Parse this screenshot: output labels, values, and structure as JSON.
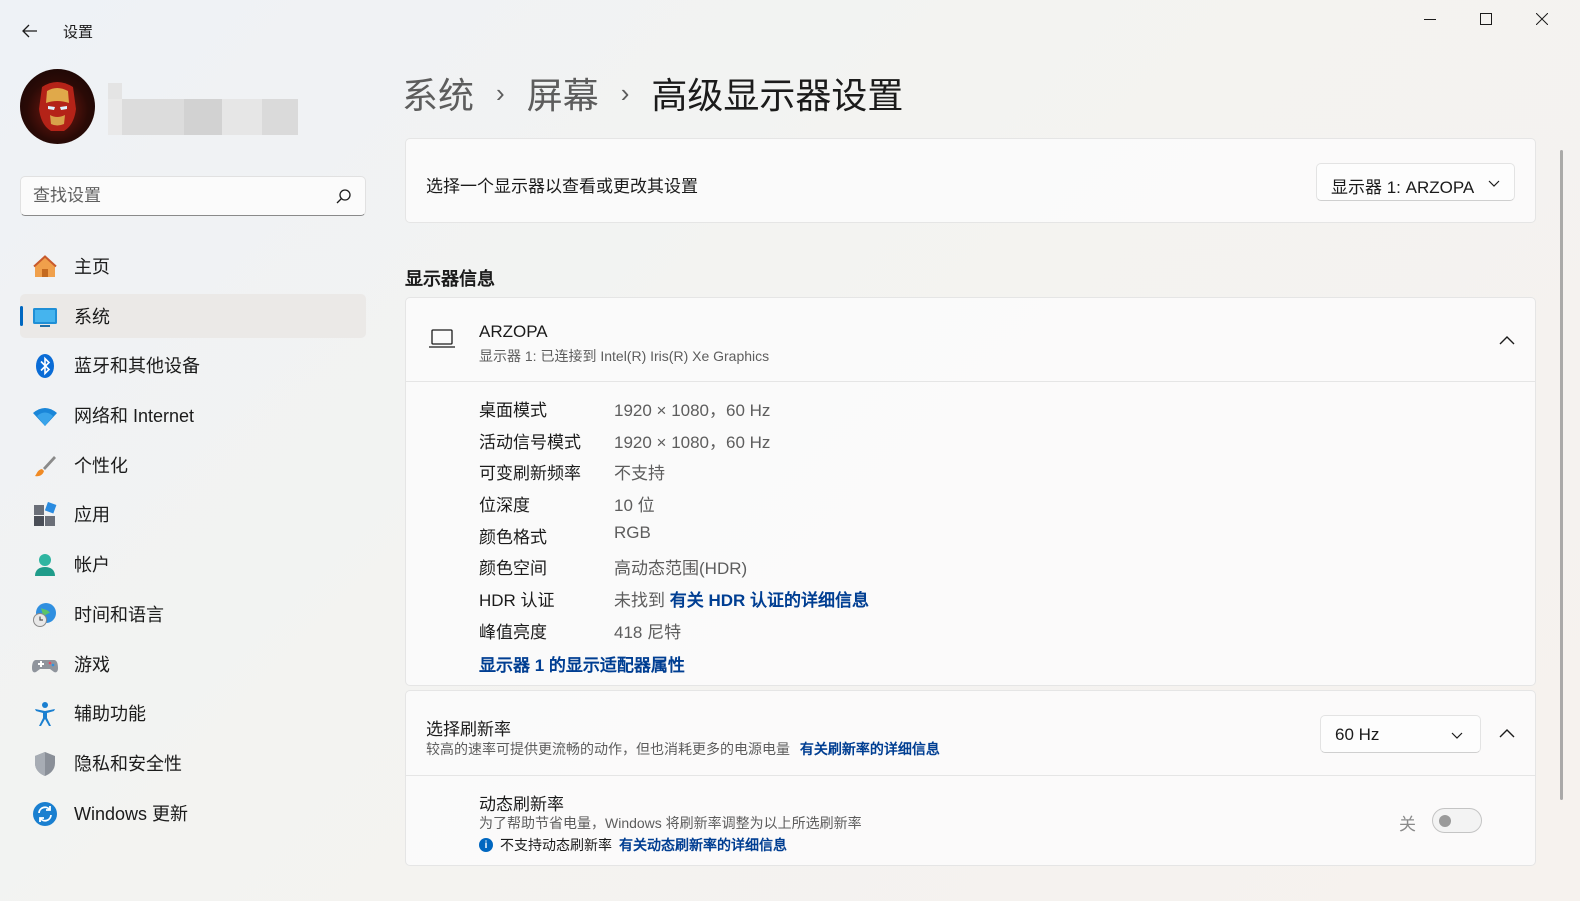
{
  "window": {
    "title": "设置"
  },
  "sidebar": {
    "search_placeholder": "查找设置",
    "items": [
      {
        "label": "主页",
        "icon": "home-icon"
      },
      {
        "label": "系统",
        "icon": "system-icon",
        "active": true
      },
      {
        "label": "蓝牙和其他设备",
        "icon": "bluetooth-icon"
      },
      {
        "label": "网络和 Internet",
        "icon": "wifi-icon"
      },
      {
        "label": "个性化",
        "icon": "brush-icon"
      },
      {
        "label": "应用",
        "icon": "apps-icon"
      },
      {
        "label": "帐户",
        "icon": "account-icon"
      },
      {
        "label": "时间和语言",
        "icon": "time-language-icon"
      },
      {
        "label": "游戏",
        "icon": "gamepad-icon"
      },
      {
        "label": "辅助功能",
        "icon": "accessibility-icon"
      },
      {
        "label": "隐私和安全性",
        "icon": "shield-icon"
      },
      {
        "label": "Windows 更新",
        "icon": "update-icon"
      }
    ]
  },
  "breadcrumb": {
    "level1": "系统",
    "level2": "屏幕",
    "current": "高级显示器设置"
  },
  "monitor_select": {
    "label": "选择一个显示器以查看或更改其设置",
    "value": "显示器 1: ARZOPA"
  },
  "display_info": {
    "section_title": "显示器信息",
    "name": "ARZOPA",
    "subtitle": "显示器 1: 已连接到 Intel(R) Iris(R) Xe Graphics",
    "rows": [
      {
        "key": "桌面模式",
        "value": "1920 × 1080，60 Hz"
      },
      {
        "key": "活动信号模式",
        "value": "1920 × 1080，60 Hz"
      },
      {
        "key": "可变刷新频率",
        "value": "不支持"
      },
      {
        "key": "位深度",
        "value": "10 位"
      },
      {
        "key": "颜色格式",
        "value": "RGB"
      },
      {
        "key": "颜色空间",
        "value": "高动态范围(HDR)"
      },
      {
        "key": "HDR 认证",
        "value": "未找到",
        "link": "有关 HDR 认证的详细信息"
      },
      {
        "key": "峰值亮度",
        "value": "418 尼特"
      }
    ],
    "adapter_link": "显示器 1 的显示适配器属性"
  },
  "refresh": {
    "title": "选择刷新率",
    "description": "较高的速率可提供更流畅的动作，但也消耗更多的电源电量",
    "link": "有关刷新率的详细信息",
    "value": "60 Hz",
    "dynamic": {
      "title": "动态刷新率",
      "description": "为了帮助节省电量，Windows 将刷新率调整为以上所选刷新率",
      "note": "不支持动态刷新率",
      "note_link": "有关动态刷新率的详细信息",
      "toggle_label": "关",
      "toggle_on": false
    }
  },
  "colors": {
    "accent": "#0067c0",
    "link": "#003e92"
  }
}
